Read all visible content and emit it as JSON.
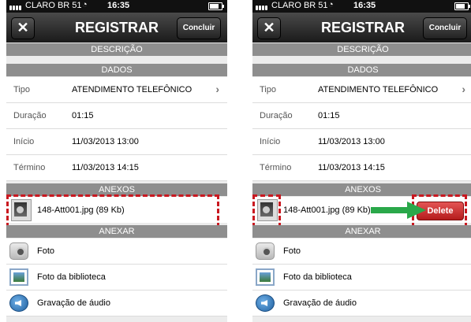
{
  "status_bar": {
    "carrier": "CLARO BR 51",
    "time": "16:35"
  },
  "nav": {
    "close_label": "✕",
    "title": "REGISTRAR",
    "done_label": "Concluir"
  },
  "sections": {
    "descricao": "DESCRIÇÃO",
    "dados": "DADOS",
    "anexos": "ANEXOS",
    "anexar": "ANEXAR"
  },
  "fields": [
    {
      "label": "Tipo",
      "value": "ATENDIMENTO TELEFÔNICO"
    },
    {
      "label": "Duração",
      "value": "01:15"
    },
    {
      "label": "Início",
      "value": "11/03/2013 13:00"
    },
    {
      "label": "Término",
      "value": "11/03/2013 14:15"
    }
  ],
  "attachment": {
    "name": "148-Att001.jpg (89 Kb)"
  },
  "delete_label": "Delete",
  "add_options": [
    {
      "label": "Foto",
      "icon": "camera-icon"
    },
    {
      "label": "Foto da biblioteca",
      "icon": "photo-library-icon"
    },
    {
      "label": "Gravação de áudio",
      "icon": "audio-recording-icon"
    }
  ],
  "colors": {
    "highlight_dash": "#c91820",
    "arrow": "#2aa84a",
    "delete": "#c62828",
    "section_header": "#8e8e8e"
  }
}
